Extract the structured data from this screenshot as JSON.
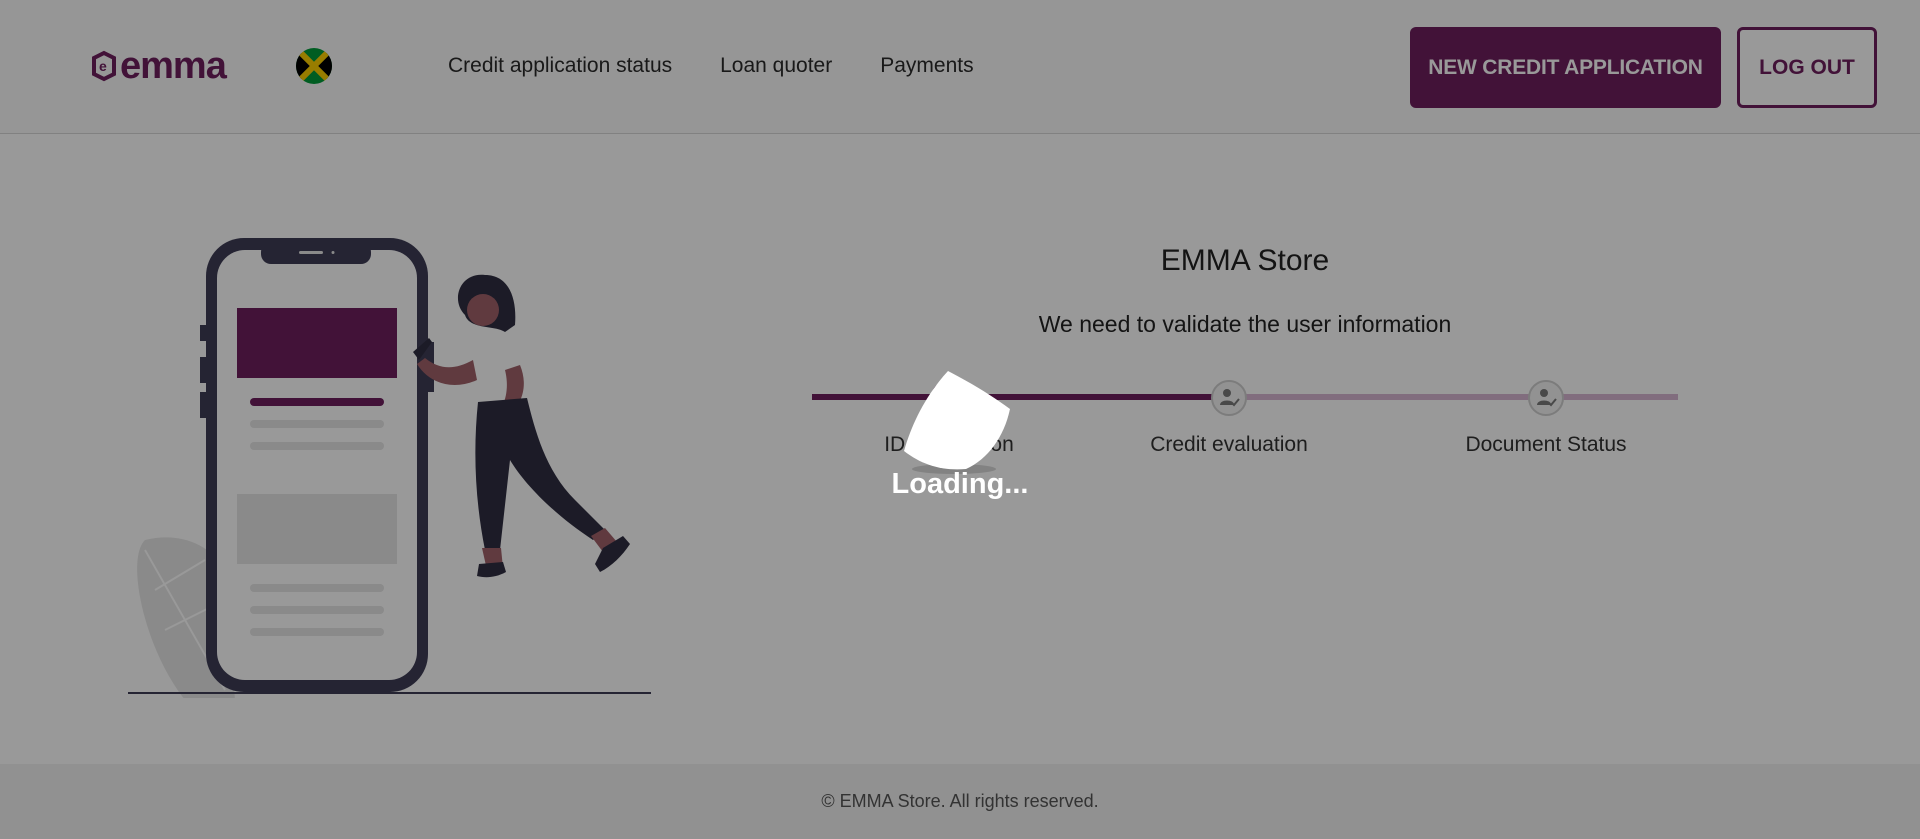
{
  "header": {
    "logo_text": "emma",
    "nav": [
      {
        "label": "Credit application status"
      },
      {
        "label": "Loan quoter"
      },
      {
        "label": "Payments"
      }
    ],
    "new_application_label": "NEW CREDIT APPLICATION",
    "logout_label": "LOG OUT"
  },
  "main": {
    "store_name": "EMMA Store",
    "subtitle": "We need to validate the user information",
    "steps": [
      {
        "label": "ID Verification",
        "status": "completed"
      },
      {
        "label": "Credit evaluation",
        "status": "pending"
      },
      {
        "label": "Document Status",
        "status": "pending"
      }
    ],
    "progress": 0.35
  },
  "footer": {
    "copyright": "© EMMA Store. All rights reserved."
  },
  "overlay": {
    "loading_text": "Loading..."
  },
  "colors": {
    "brand": "#6e1f5e",
    "brand_light": "#d8b6d2",
    "overlay": "rgba(0,0,0,0.4)"
  },
  "icons": {
    "step": "user-check-icon",
    "flag": "jamaica-flag-icon"
  }
}
